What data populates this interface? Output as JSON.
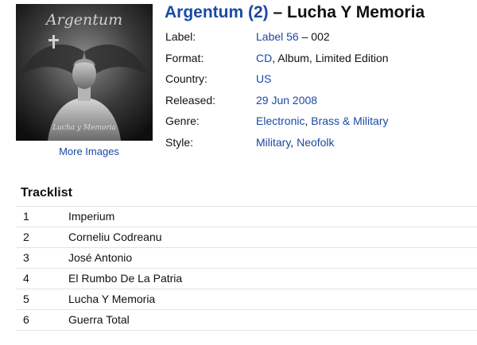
{
  "release": {
    "cover": {
      "band_lettering": "Argentum",
      "subtitle_lettering": "Lucha y Memoria"
    },
    "more_images": "More Images",
    "title": {
      "artist": "Argentum (2)",
      "separator": " – ",
      "album": "Lucha Y Memoria"
    },
    "info": {
      "label_key": "Label:",
      "label_name": "Label 56",
      "label_cat": " – 002",
      "format_key": "Format:",
      "format_cd": "CD",
      "format_rest": ", Album, Limited Edition",
      "country_key": "Country:",
      "country": "US",
      "released_key": "Released:",
      "released": "29 Jun 2008",
      "genre_key": "Genre:",
      "genre_1": "Electronic",
      "genre_sep": ", ",
      "genre_2": "Brass & Military",
      "style_key": "Style:",
      "style_1": "Military",
      "style_sep": ", ",
      "style_2": "Neofolk"
    }
  },
  "tracklist": {
    "heading": "Tracklist",
    "tracks": [
      {
        "position": "1",
        "title": "Imperium"
      },
      {
        "position": "2",
        "title": "Corneliu Codreanu"
      },
      {
        "position": "3",
        "title": "José Antonio"
      },
      {
        "position": "4",
        "title": "El Rumbo De La Patria"
      },
      {
        "position": "5",
        "title": "Lucha Y Memoria"
      },
      {
        "position": "6",
        "title": "Guerra Total"
      }
    ]
  },
  "colors": {
    "link": "#1b49a5",
    "divider": "#e2e2e2"
  }
}
